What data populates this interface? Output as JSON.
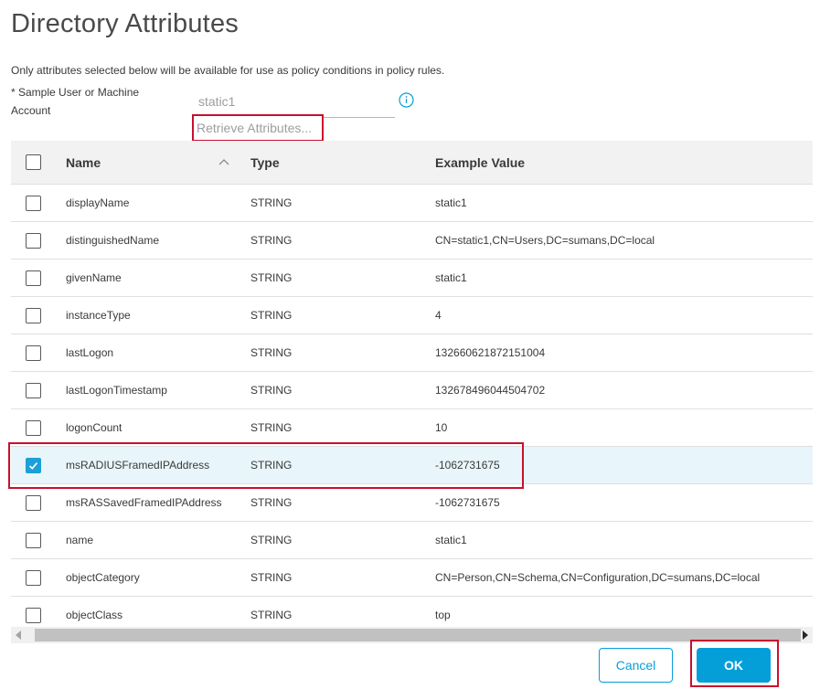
{
  "dialog": {
    "title": "Directory Attributes",
    "intro": "Only attributes selected below will be available for use as policy conditions in policy rules.",
    "sample_label": "* Sample User or Machine Account",
    "sample_value": "static1",
    "info_icon": "info-circle-icon",
    "retrieve_label": "Retrieve Attributes..."
  },
  "table": {
    "headers": {
      "name": "Name",
      "type": "Type",
      "example": "Example Value"
    },
    "sort_icon": "chevron-up-icon",
    "rows": [
      {
        "name": "displayName",
        "type": "STRING",
        "example": "static1",
        "checked": false
      },
      {
        "name": "distinguishedName",
        "type": "STRING",
        "example": "CN=static1,CN=Users,DC=sumans,DC=local",
        "checked": false
      },
      {
        "name": "givenName",
        "type": "STRING",
        "example": "static1",
        "checked": false
      },
      {
        "name": "instanceType",
        "type": "STRING",
        "example": "4",
        "checked": false
      },
      {
        "name": "lastLogon",
        "type": "STRING",
        "example": "132660621872151004",
        "checked": false
      },
      {
        "name": "lastLogonTimestamp",
        "type": "STRING",
        "example": "132678496044504702",
        "checked": false
      },
      {
        "name": "logonCount",
        "type": "STRING",
        "example": "10",
        "checked": false
      },
      {
        "name": "msRADIUSFramedIPAddress",
        "type": "STRING",
        "example": "-1062731675",
        "checked": true
      },
      {
        "name": "msRASSavedFramedIPAddress",
        "type": "STRING",
        "example": "-1062731675",
        "checked": false
      },
      {
        "name": "name",
        "type": "STRING",
        "example": "static1",
        "checked": false
      },
      {
        "name": "objectCategory",
        "type": "STRING",
        "example": "CN=Person,CN=Schema,CN=Configuration,DC=sumans,DC=local",
        "checked": false
      },
      {
        "name": "objectClass",
        "type": "STRING",
        "example": "top",
        "checked": false
      }
    ]
  },
  "footer": {
    "cancel_label": "Cancel",
    "ok_label": "OK"
  },
  "colors": {
    "accent": "#049fd9",
    "highlight": "#c8102e",
    "selected_row": "#e8f5fa"
  }
}
